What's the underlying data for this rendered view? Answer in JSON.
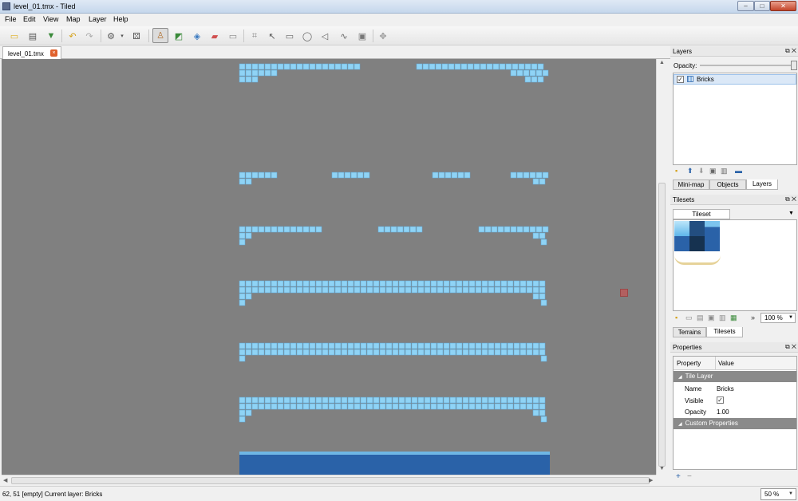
{
  "window": {
    "title": "level_01.tmx - Tiled",
    "controls": [
      "–",
      "□",
      "✕"
    ]
  },
  "menu": [
    "File",
    "Edit",
    "View",
    "Map",
    "Layer",
    "Help"
  ],
  "toolbar": {
    "buttons": [
      "new-file",
      "open-file",
      "save-file",
      "undo",
      "redo",
      "command",
      "tileset-dropdown",
      "random-mode",
      "stamp-brush",
      "terrain-brush",
      "bucket-fill",
      "eraser",
      "rect-select",
      "magic-wand",
      "edit-polygons",
      "insert-rectangle",
      "insert-ellipse",
      "insert-polygon",
      "insert-polyline",
      "insert-tile",
      "select-objects",
      "rotate"
    ],
    "active": "stamp-brush"
  },
  "document_tab": {
    "label": "level_01.tmx"
  },
  "map": {
    "background": "#808080",
    "brick_color": "#8fd3f5",
    "paddle_color": "#2a62a8"
  },
  "status": {
    "text": "62, 51 [empty]  Current layer: Bricks",
    "zoom": "50 %"
  },
  "layers_panel": {
    "title": "Layers",
    "opacity_label": "Opacity:",
    "layers": [
      {
        "name": "Bricks",
        "visible": true
      }
    ],
    "tabs": [
      "Mini-map",
      "Objects",
      "Layers"
    ],
    "selected_tab": "Layers"
  },
  "tilesets_panel": {
    "title": "Tilesets",
    "tab_label": "Tileset",
    "zoom": "100 %",
    "tabs": [
      "Terrains",
      "Tilesets"
    ],
    "selected_tab": "Tilesets"
  },
  "properties_panel": {
    "title": "Properties",
    "header_property": "Property",
    "header_value": "Value",
    "section": "Tile Layer",
    "rows": [
      {
        "name": "Name",
        "value": "Bricks"
      },
      {
        "name": "Visible",
        "value": "✓"
      },
      {
        "name": "Opacity",
        "value": "1.00"
      }
    ],
    "custom_section": "Custom Properties"
  }
}
